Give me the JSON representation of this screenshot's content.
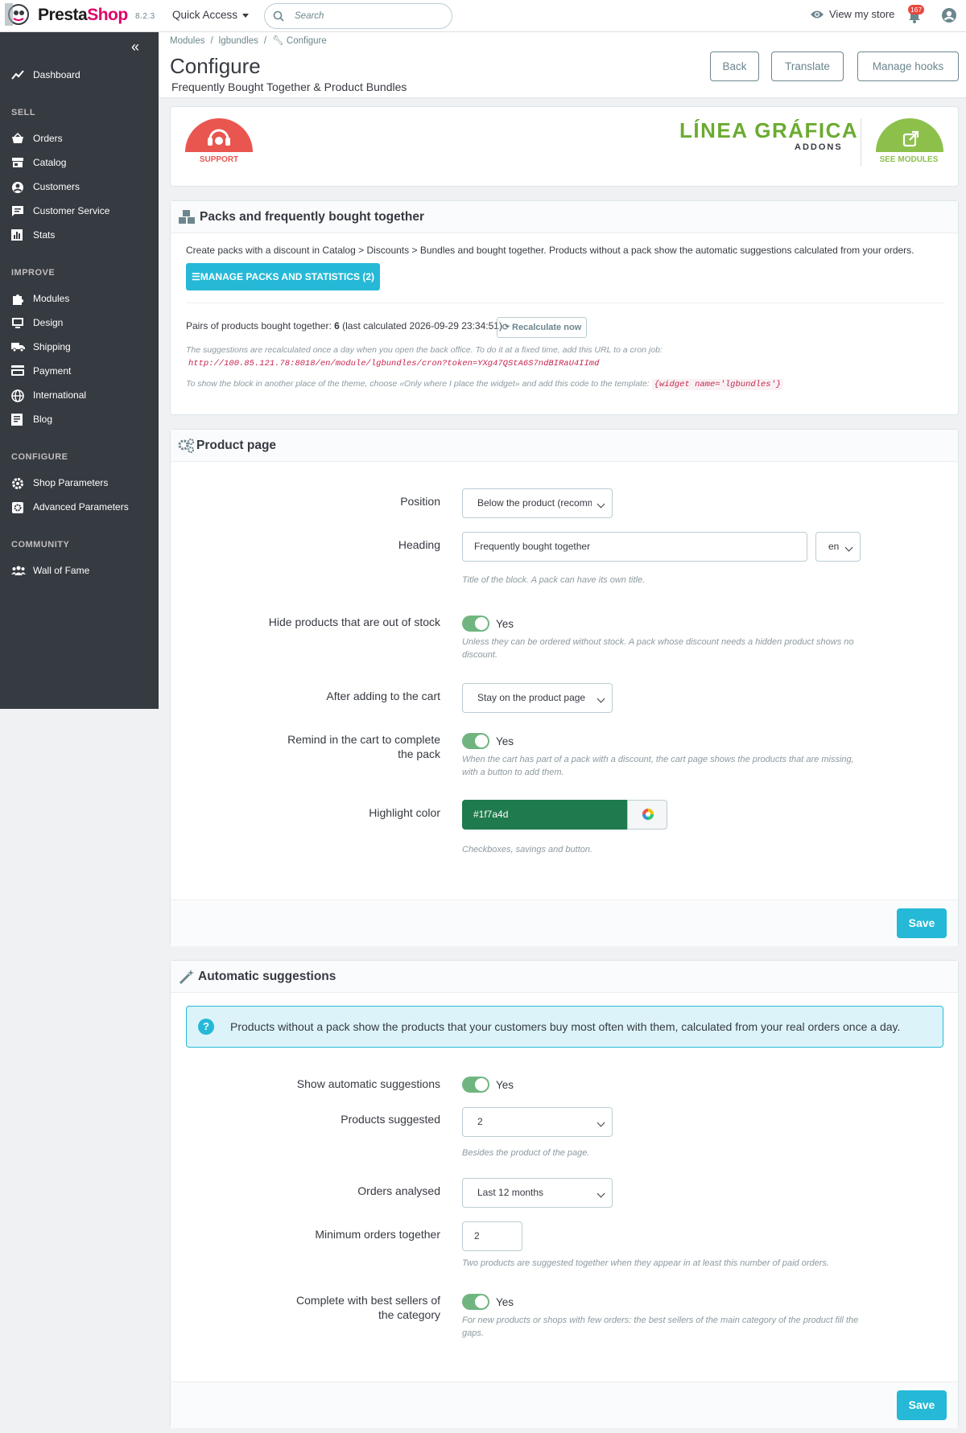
{
  "header": {
    "brand_part1": "Presta",
    "brand_part2": "Shop",
    "version": "8.2.3",
    "quick_access": "Quick Access",
    "search_placeholder": "Search",
    "view_store": "View my store",
    "notifications": "167"
  },
  "sidebar": {
    "items": [
      {
        "label": "Dashboard",
        "icon": "trending-up-icon"
      },
      {
        "label": "SELL",
        "section": true
      },
      {
        "label": "Orders",
        "icon": "basket-icon"
      },
      {
        "label": "Catalog",
        "icon": "store-icon"
      },
      {
        "label": "Customers",
        "icon": "account-circle-icon"
      },
      {
        "label": "Customer Service",
        "icon": "chat-icon"
      },
      {
        "label": "Stats",
        "icon": "bar-chart-icon"
      },
      {
        "label": "IMPROVE",
        "section": true
      },
      {
        "label": "Modules",
        "icon": "puzzle-icon"
      },
      {
        "label": "Design",
        "icon": "desktop-icon"
      },
      {
        "label": "Shipping",
        "icon": "truck-icon"
      },
      {
        "label": "Payment",
        "icon": "credit-card-icon"
      },
      {
        "label": "International",
        "icon": "globe-icon"
      },
      {
        "label": "Blog",
        "icon": "blog-icon"
      },
      {
        "label": "CONFIGURE",
        "section": true
      },
      {
        "label": "Shop Parameters",
        "icon": "settings-icon"
      },
      {
        "label": "Advanced Parameters",
        "icon": "advanced-settings-icon"
      },
      {
        "label": "COMMUNITY",
        "section": true
      },
      {
        "label": "Wall of Fame",
        "icon": "people-icon"
      }
    ]
  },
  "page": {
    "breadcrumb": [
      "Modules",
      "lgbundles",
      "Configure"
    ],
    "title": "Configure",
    "subtitle": "Frequently Bought Together & Product Bundles",
    "buttons": {
      "back": "Back",
      "translate": "Translate",
      "manage_hooks": "Manage hooks"
    }
  },
  "brandcard": {
    "support": "SUPPORT",
    "logo_main": "LÍNEA GRÁFICA",
    "logo_sub": "ADDONS",
    "see_modules": "SEE MODULES"
  },
  "packs": {
    "title": "Packs and frequently bought together",
    "intro": "Create packs with a discount in Catalog > Discounts > Bundles and bought together. Products without a pack show the automatic suggestions calculated from your orders.",
    "manage_btn": "MANAGE PACKS AND STATISTICS (2)",
    "pairs_label": "Pairs of products bought together: ",
    "pairs_count": "6",
    "pairs_calc": " (last calculated 2026-09-29 23:34:51)",
    "recalc_btn": "Recalculate now",
    "cron_help": "The suggestions are recalculated once a day when you open the back office. To do it at a fixed time, add this URL to a cron job:",
    "cron_url": "http://100.85.121.78:8018/en/module/lgbundles/cron?token=YXg47QStA6S7ndBIRaU4IImd",
    "widget_help": "To show the block in another place of the theme, choose «Only where I place the widget» and add this code to the template:",
    "widget_code": "{widget name='lgbundles'}"
  },
  "product_page": {
    "title": "Product page",
    "position_label": "Position",
    "position_value": "Below the product (recommended)",
    "heading_label": "Heading",
    "heading_value": "Frequently bought together",
    "heading_lang": "en",
    "heading_help": "Title of the block. A pack can have its own title.",
    "hide_label": "Hide products that are out of stock",
    "hide_value": "Yes",
    "hide_help": "Unless they can be ordered without stock. A pack whose discount needs a hidden product shows no discount.",
    "after_label": "After adding to the cart",
    "after_value": "Stay on the product page",
    "remind_label": "Remind in the cart to complete the pack",
    "remind_value": "Yes",
    "remind_help": "When the cart has part of a pack with a discount, the cart page shows the products that are missing, with a button to add them.",
    "color_label": "Highlight color",
    "color_value": "#1f7a4d",
    "color_help": "Checkboxes, savings and button.",
    "save": "Save"
  },
  "auto": {
    "title": "Automatic suggestions",
    "alert": "Products without a pack show the products that your customers buy most often with them, calculated from your real orders once a day.",
    "show_label": "Show automatic suggestions",
    "show_value": "Yes",
    "count_label": "Products suggested",
    "count_value": "2",
    "count_help": "Besides the product of the page.",
    "orders_label": "Orders analysed",
    "orders_value": "Last 12 months",
    "min_label": "Minimum orders together",
    "min_value": "2",
    "min_help": "Two products are suggested together when they appear in at least this number of paid orders.",
    "best_label": "Complete with best sellers of the category",
    "best_value": "Yes",
    "best_help": "For new products or shops with few orders: the best sellers of the main category of the product fill the gaps.",
    "save": "Save"
  },
  "colors": {
    "accent": "#25b9d7",
    "toggle_on": "#70b580",
    "sidebar": "#363a41",
    "highlight": "#1f7a4d"
  }
}
